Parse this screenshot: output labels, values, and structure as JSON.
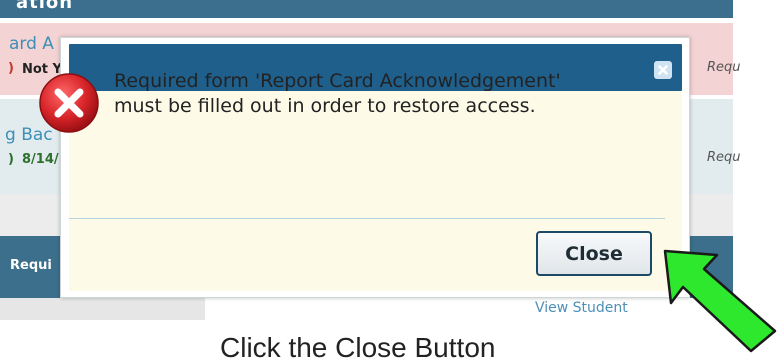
{
  "background": {
    "top_bar_text": "ation",
    "row1": {
      "link": "ard A",
      "status": "Not Y",
      "requirement": "Requ"
    },
    "row2": {
      "link": "g Bac",
      "date": "8/14/",
      "requirement": "Requ"
    },
    "row4": {
      "label": "Requi"
    },
    "view_student": "View Student"
  },
  "dialog": {
    "message": "Required form 'Report Card Acknowledgement' must be filled out in order to restore access.",
    "close_label": "Close",
    "close_x_icon": "close-icon",
    "error_icon": "error-x-icon"
  },
  "annotation": {
    "caption": "Click the Close Button",
    "arrow_color": "#2ee82e",
    "arrow_icon": "arrow-pointer-icon"
  },
  "colors": {
    "header_blue": "#1f5f8c",
    "body_cream": "#fdfbe7",
    "error_red": "#d9262b"
  }
}
